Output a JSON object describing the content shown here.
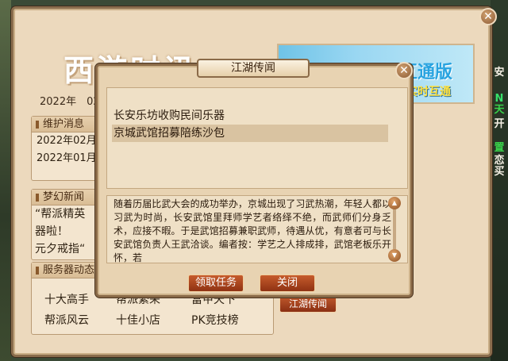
{
  "background": {
    "right_side_chars": [
      {
        "text": "安",
        "color": "#f4efe4"
      },
      {
        "text": "N",
        "color": "#37e06a"
      },
      {
        "text": "天",
        "color": "#39d24a"
      },
      {
        "text": "开",
        "color": "#f4efe4"
      },
      {
        "text": "置",
        "color": "#39d24a"
      },
      {
        "text": "恋",
        "color": "#f4efe4"
      },
      {
        "text": "买",
        "color": "#f4efe4"
      }
    ]
  },
  "main": {
    "title": "西游时讯",
    "date_line": "2022年　02",
    "maintenance": {
      "header": "维护消息",
      "items": [
        "2022年02月",
        "2022年01月"
      ]
    },
    "news": {
      "header": "梦幻新闻",
      "items": [
        "“帮派精英",
        "器啦！",
        "元夕戒指“"
      ]
    },
    "server": {
      "header": "服务器动态",
      "grid": [
        "十大高手",
        "帮派繁荣",
        "富甲天下",
        "帮派风云",
        "十佳小店",
        "PK竞技榜"
      ]
    },
    "banner": {
      "main_text": "互通版",
      "sub_text": "实时互通"
    },
    "behind_button": "江湖传闻"
  },
  "modal": {
    "title": "江湖传闻",
    "list": [
      "长安乐坊收购民间乐器",
      "京城武馆招募陪练沙包"
    ],
    "selected_index": 1,
    "story": "随着历届比武大会的成功举办，京城出现了习武热潮，年轻人都以习武为时尚，长安武馆里拜师学艺者络绎不绝，而武师们分身乏术，应接不暇。于是武馆招募兼职武师，待遇从优，有意者可与长安武馆负责人王武洽谈。编者按：学艺之人排成排，武馆老板乐开怀，若",
    "accept_button": "领取任务",
    "close_button": "关闭"
  },
  "colors": {
    "panel": "#ecd9bd",
    "button": "#8f3213",
    "border": "#8a6a48"
  }
}
